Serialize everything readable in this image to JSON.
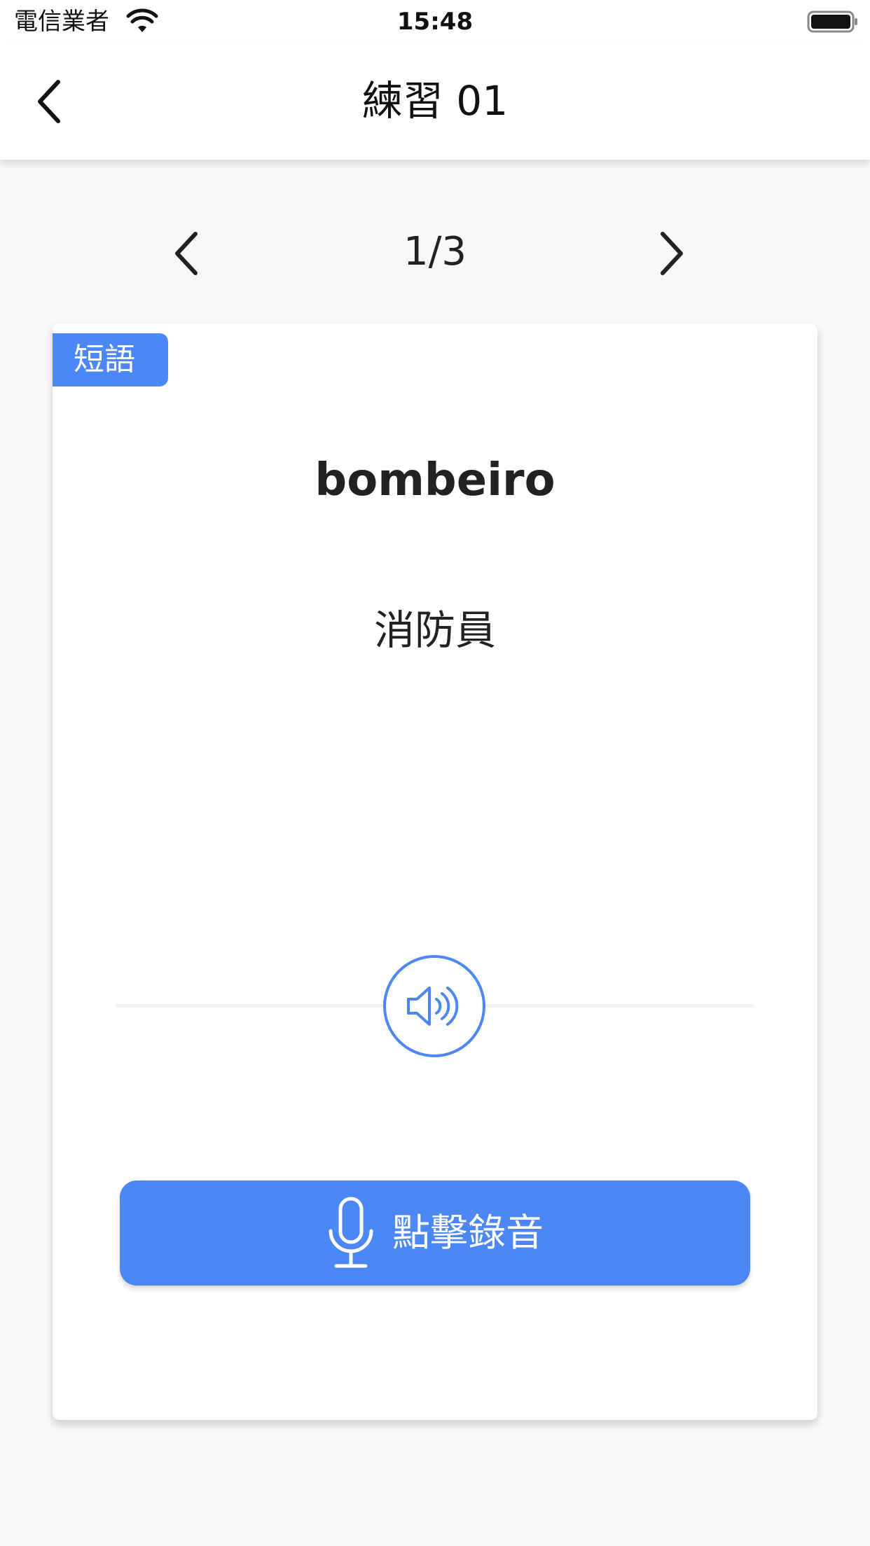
{
  "status_bar": {
    "carrier": "電信業者",
    "time": "15:48"
  },
  "nav": {
    "title": "練習 01"
  },
  "pager": {
    "count": "1/3"
  },
  "card": {
    "tag": "短語",
    "word": "bombeiro",
    "translation": "消防員",
    "record_label": "點擊錄音"
  },
  "colors": {
    "accent": "#4b87f5",
    "background": "#f8f8f8",
    "card": "#ffffff"
  },
  "icons": {
    "back": "chevron-left-icon",
    "prev": "chevron-left-icon",
    "next": "chevron-right-icon",
    "audio": "speaker-icon",
    "record": "microphone-icon"
  }
}
